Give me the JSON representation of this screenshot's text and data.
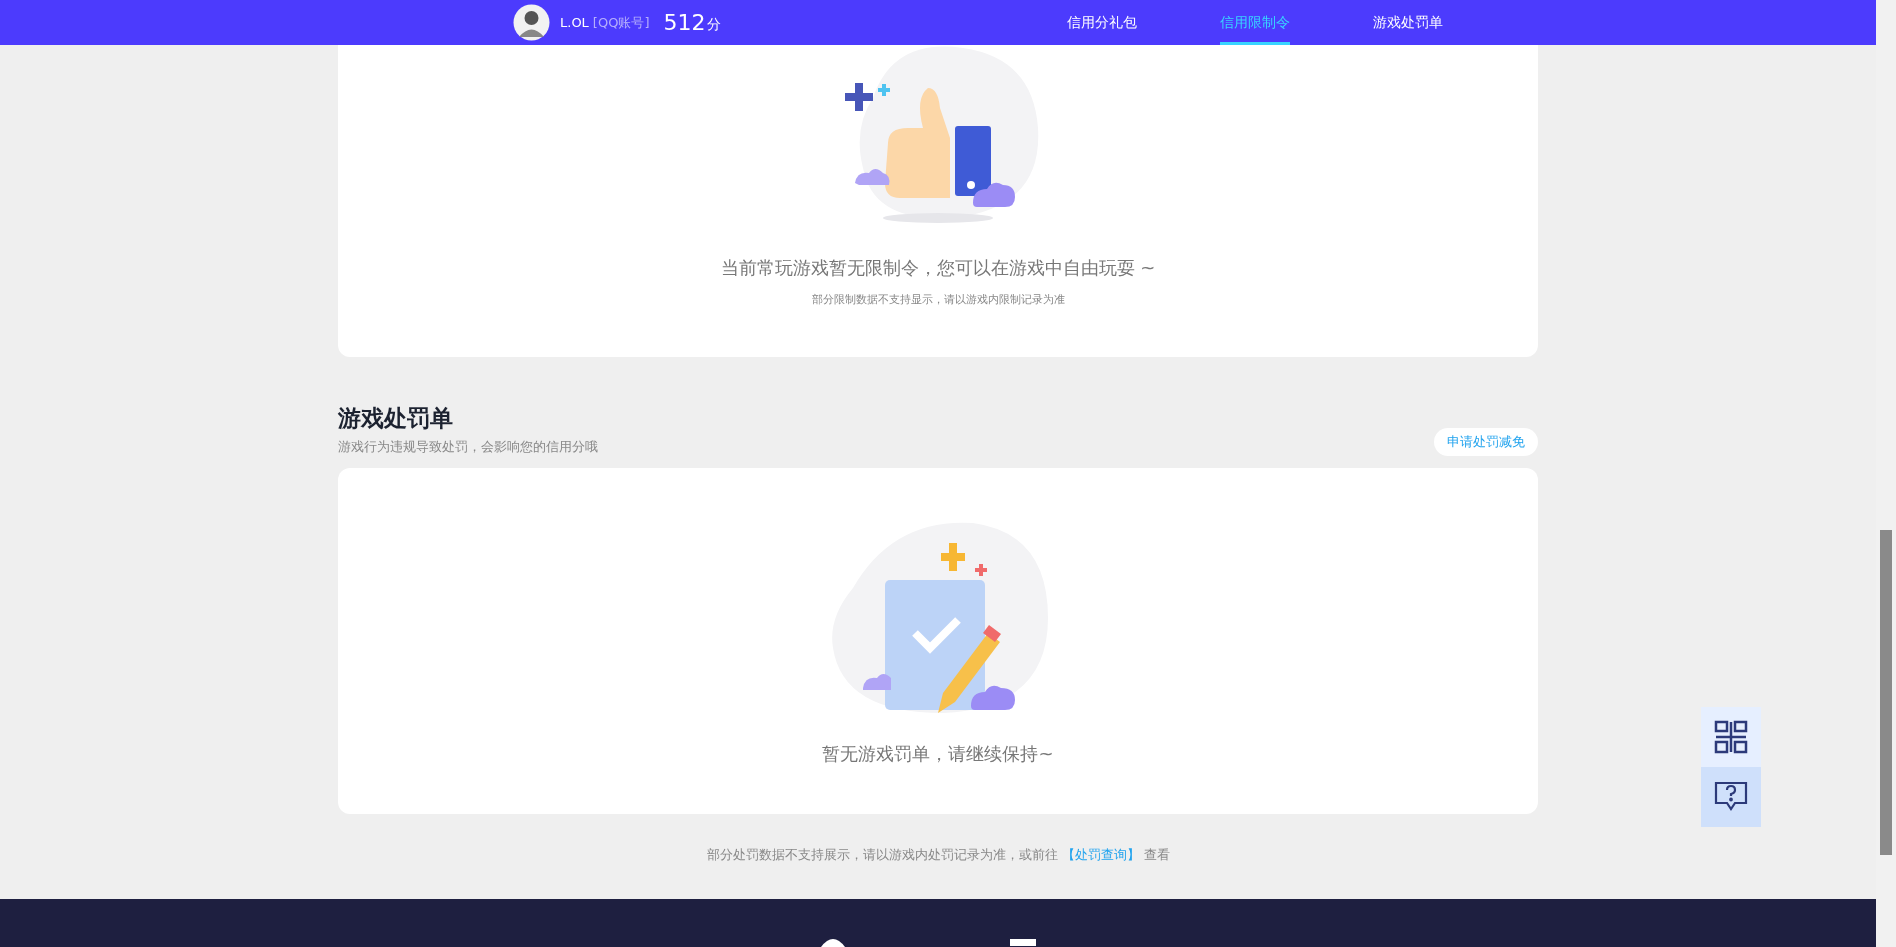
{
  "header": {
    "username": "L.OL",
    "account_tag": "[QQ账号]",
    "score": "512",
    "score_unit": "分"
  },
  "nav": [
    {
      "label": "信用分礼包",
      "selected": false
    },
    {
      "label": "信用限制令",
      "selected": true
    },
    {
      "label": "游戏处罚单",
      "selected": false
    }
  ],
  "restriction_card": {
    "message": "当前常玩游戏暂无限制令，您可以在游戏中自由玩耍 ~",
    "note": "部分限制数据不支持显示，请以游戏内限制记录为准"
  },
  "penalty_section": {
    "title": "游戏处罚单",
    "subtitle": "游戏行为违规导致处罚，会影响您的信用分哦",
    "action_button": "申请处罚减免",
    "empty_message": "暂无游戏罚单，请继续保持~"
  },
  "footer_note": {
    "text_before": "部分处罚数据不支持展示，请以游戏内处罚记录为准，或前往",
    "link": "【处罚查询】",
    "text_after": "查看"
  }
}
